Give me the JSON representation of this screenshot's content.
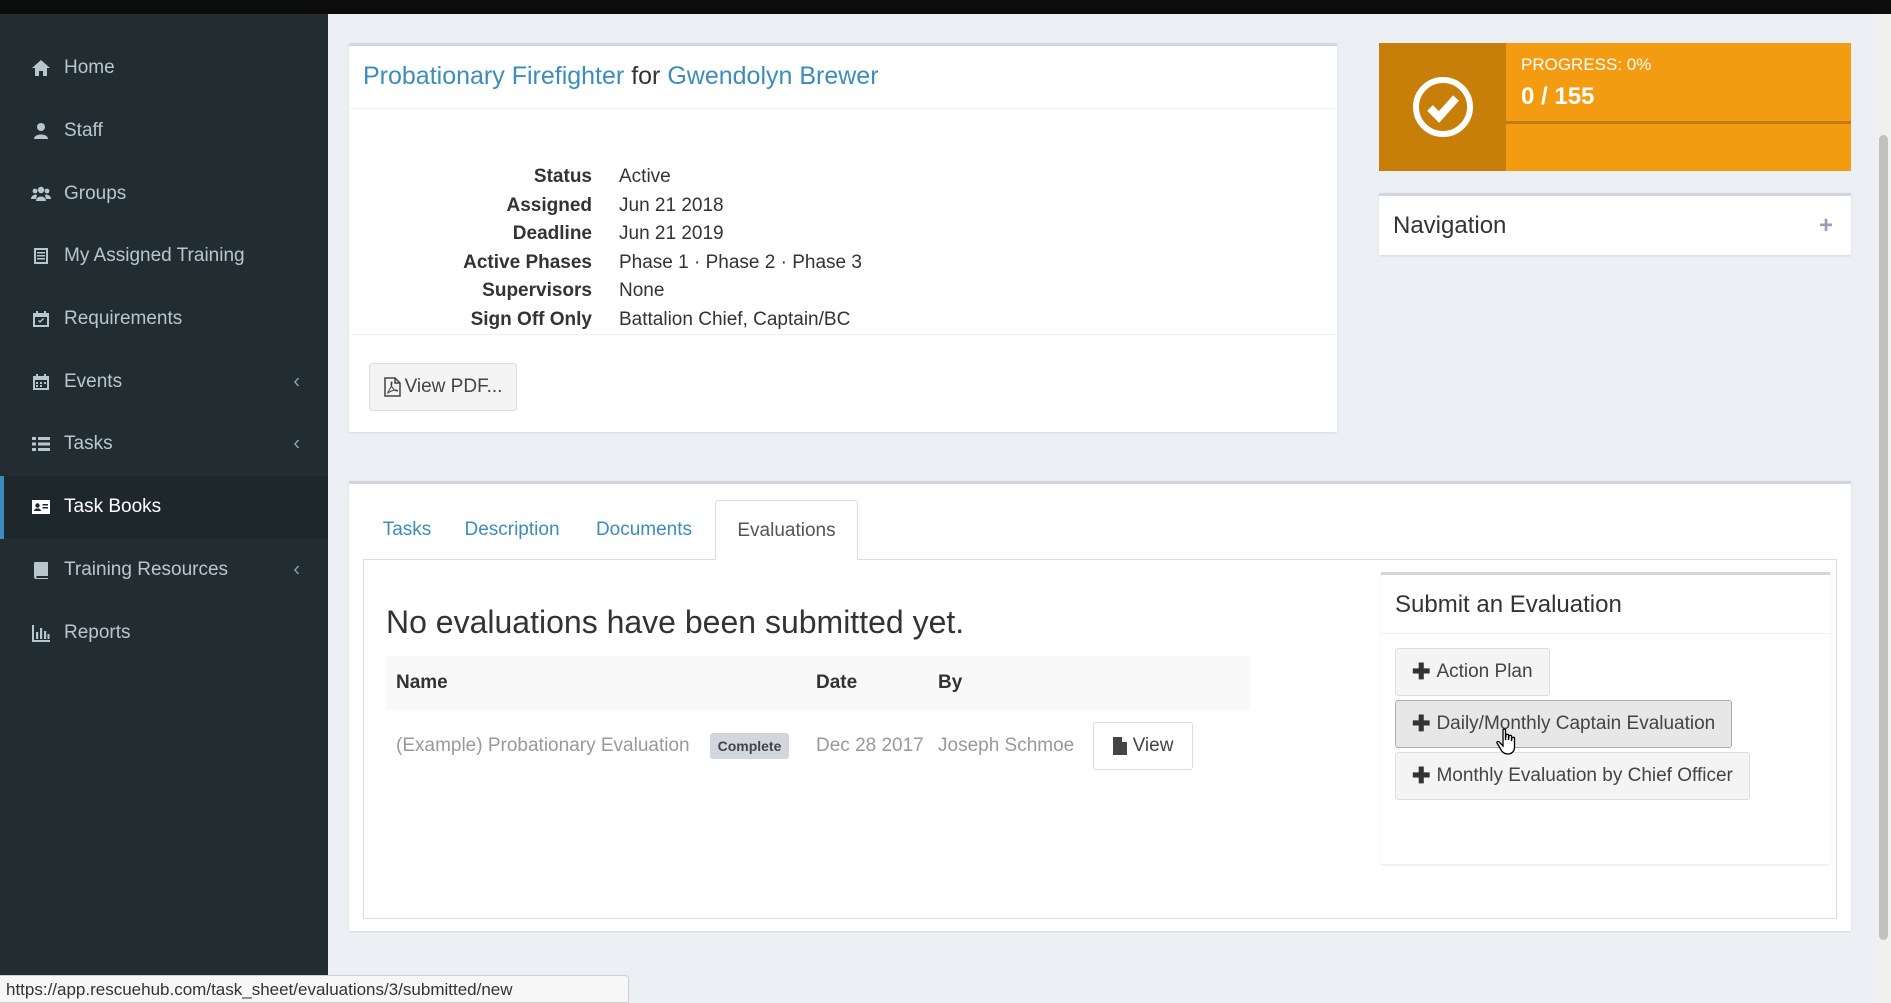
{
  "sidebar": {
    "items": [
      {
        "label": "Home",
        "icon": "home-icon"
      },
      {
        "label": "Staff",
        "icon": "user-icon"
      },
      {
        "label": "Groups",
        "icon": "users-icon"
      },
      {
        "label": "My Assigned Training",
        "icon": "list-alt-icon"
      },
      {
        "label": "Requirements",
        "icon": "calendar-check-icon"
      },
      {
        "label": "Events",
        "icon": "calendar-icon",
        "has_submenu": true
      },
      {
        "label": "Tasks",
        "icon": "list-icon",
        "has_submenu": true
      },
      {
        "label": "Task Books",
        "icon": "address-card-icon",
        "active": true
      },
      {
        "label": "Training Resources",
        "icon": "book-icon",
        "has_submenu": true
      },
      {
        "label": "Reports",
        "icon": "bar-chart-icon"
      }
    ]
  },
  "taskbook": {
    "title_role": "Probationary Firefighter",
    "title_for": "for",
    "title_person": "Gwendolyn Brewer",
    "details": [
      {
        "label": "Status",
        "value": "Active"
      },
      {
        "label": "Assigned",
        "value": "Jun 21 2018"
      },
      {
        "label": "Deadline",
        "value": "Jun 21 2019"
      },
      {
        "label": "Active Phases",
        "value": "Phase 1 · Phase 2 · Phase 3"
      },
      {
        "label": "Supervisors",
        "value": "None"
      },
      {
        "label": "Sign Off Only",
        "value": "Battalion Chief, Captain/BC"
      }
    ],
    "view_pdf_label": "View PDF..."
  },
  "progress": {
    "label": "PROGRESS: 0%",
    "count": "0 / 155",
    "fraction": 0.0,
    "color": "#f39c12",
    "icon_bg": "#c87f0a"
  },
  "navigation": {
    "title": "Navigation",
    "toggle": "+"
  },
  "tabs": {
    "items": [
      "Tasks",
      "Description",
      "Documents",
      "Evaluations"
    ],
    "active_index": 3
  },
  "evaluations": {
    "empty_message": "No evaluations have been submitted yet.",
    "columns": [
      "Name",
      "Date",
      "By"
    ],
    "rows": [
      {
        "name": "(Example) Probationary Evaluation",
        "status": "Complete",
        "date": "Dec 28 2017",
        "by": "Joseph Schmoe",
        "action": "View"
      }
    ]
  },
  "submit": {
    "title": "Submit an Evaluation",
    "buttons": [
      "Action Plan",
      "Daily/Monthly Captain Evaluation",
      "Monthly Evaluation by Chief Officer"
    ]
  },
  "statusbar": {
    "url": "https://app.rescuehub.com/task_sheet/evaluations/3/submitted/new"
  },
  "colors": {
    "link": "#3c8dbc",
    "sidebar_bg": "#222d32",
    "page_bg": "#ecf0f5"
  }
}
